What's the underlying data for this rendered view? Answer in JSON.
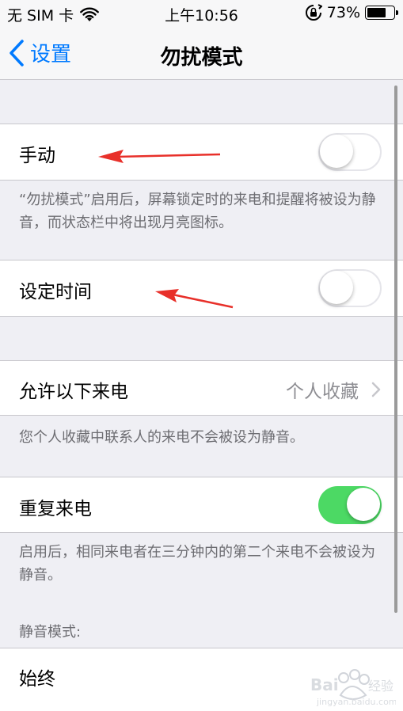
{
  "status_bar": {
    "carrier": "无 SIM 卡",
    "time": "上午10:56",
    "battery_percent": "73%",
    "battery_level": 0.73
  },
  "nav": {
    "back_label": "设置",
    "title": "勿扰模式"
  },
  "sections": {
    "manual": {
      "label": "手动",
      "toggle_on": false,
      "footer": "“勿扰模式”启用后，屏幕锁定时的来电和提醒将被设为静音，而状态栏中将出现月亮图标。"
    },
    "scheduled": {
      "label": "设定时间",
      "toggle_on": false
    },
    "allow_calls": {
      "label": "允许以下来电",
      "value": "个人收藏",
      "footer": "您个人收藏中联系人的来电不会被设为静音。"
    },
    "repeated_calls": {
      "label": "重复来电",
      "toggle_on": true,
      "footer": "启用后，相同来电者在三分钟内的第二个来电不会被设为静音。"
    },
    "silence": {
      "header": "静音模式:",
      "option": "始终"
    }
  },
  "colors": {
    "accent": "#007aff",
    "toggle_on": "#4cd964",
    "annotation_arrow": "#e8302a",
    "background": "#efeff4"
  }
}
